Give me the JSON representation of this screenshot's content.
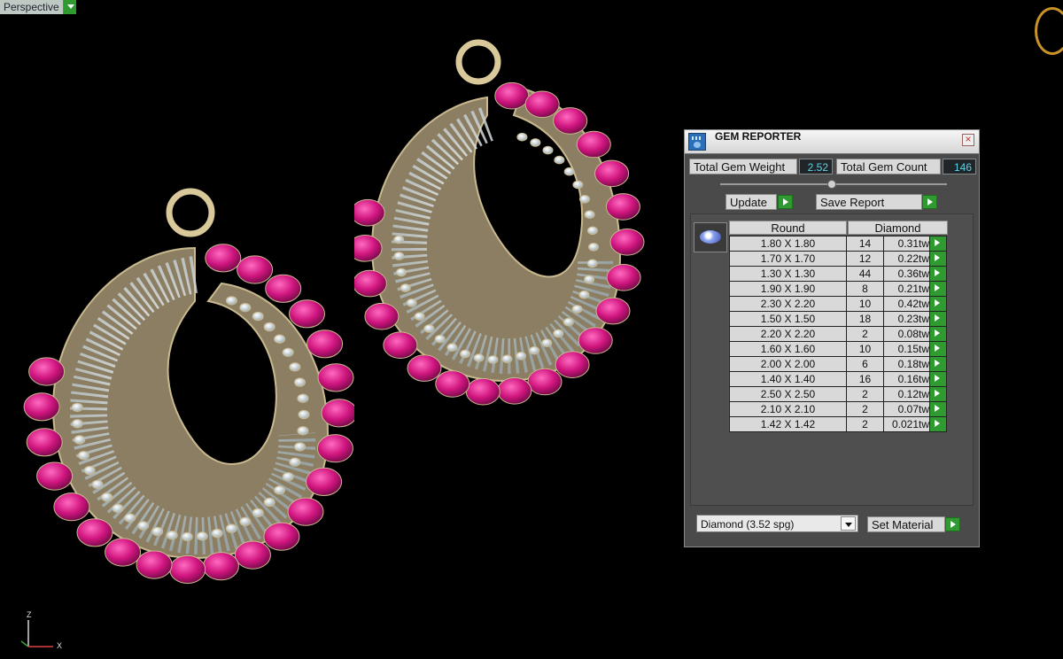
{
  "viewport": {
    "label": "Perspective",
    "axis_z": "Z",
    "axis_x": "X"
  },
  "panel": {
    "title": "GEM REPORTER",
    "close_glyph": "×",
    "total_weight_label": "Total Gem Weight",
    "total_weight_value": "2.52",
    "total_count_label": "Total Gem Count",
    "total_count_value": "146",
    "update_label": "Update",
    "save_report_label": "Save Report",
    "col_shape": "Round",
    "col_material": "Diamond",
    "rows": [
      {
        "size": "1.80 X 1.80",
        "count": "14",
        "weight": "0.31tw"
      },
      {
        "size": "1.70 X 1.70",
        "count": "12",
        "weight": "0.22tw"
      },
      {
        "size": "1.30 X 1.30",
        "count": "44",
        "weight": "0.36tw"
      },
      {
        "size": "1.90 X 1.90",
        "count": "8",
        "weight": "0.21tw"
      },
      {
        "size": "2.30 X 2.20",
        "count": "10",
        "weight": "0.42tw"
      },
      {
        "size": "1.50 X 1.50",
        "count": "18",
        "weight": "0.23tw"
      },
      {
        "size": "2.20 X 2.20",
        "count": "2",
        "weight": "0.08tw"
      },
      {
        "size": "1.60 X 1.60",
        "count": "10",
        "weight": "0.15tw"
      },
      {
        "size": "2.00 X 2.00",
        "count": "6",
        "weight": "0.18tw"
      },
      {
        "size": "1.40 X 1.40",
        "count": "16",
        "weight": "0.16tw"
      },
      {
        "size": "2.50 X 2.50",
        "count": "2",
        "weight": "0.12tw"
      },
      {
        "size": "2.10 X 2.10",
        "count": "2",
        "weight": "0.07tw"
      },
      {
        "size": "1.42 X 1.42",
        "count": "2",
        "weight": "0.021tw"
      }
    ],
    "material_select_value": "Diamond    (3.52 spg)",
    "set_material_label": "Set Material"
  },
  "colors": {
    "ruby": "#d0157f",
    "gold": "#b8a27a",
    "diamond": "#e8eef0",
    "accent_green": "#2f9a2f"
  },
  "icons": [
    "gem-reporter-icon",
    "close-icon",
    "play-icon",
    "round-diamond-icon",
    "chevron-down-icon",
    "compass-icon"
  ]
}
